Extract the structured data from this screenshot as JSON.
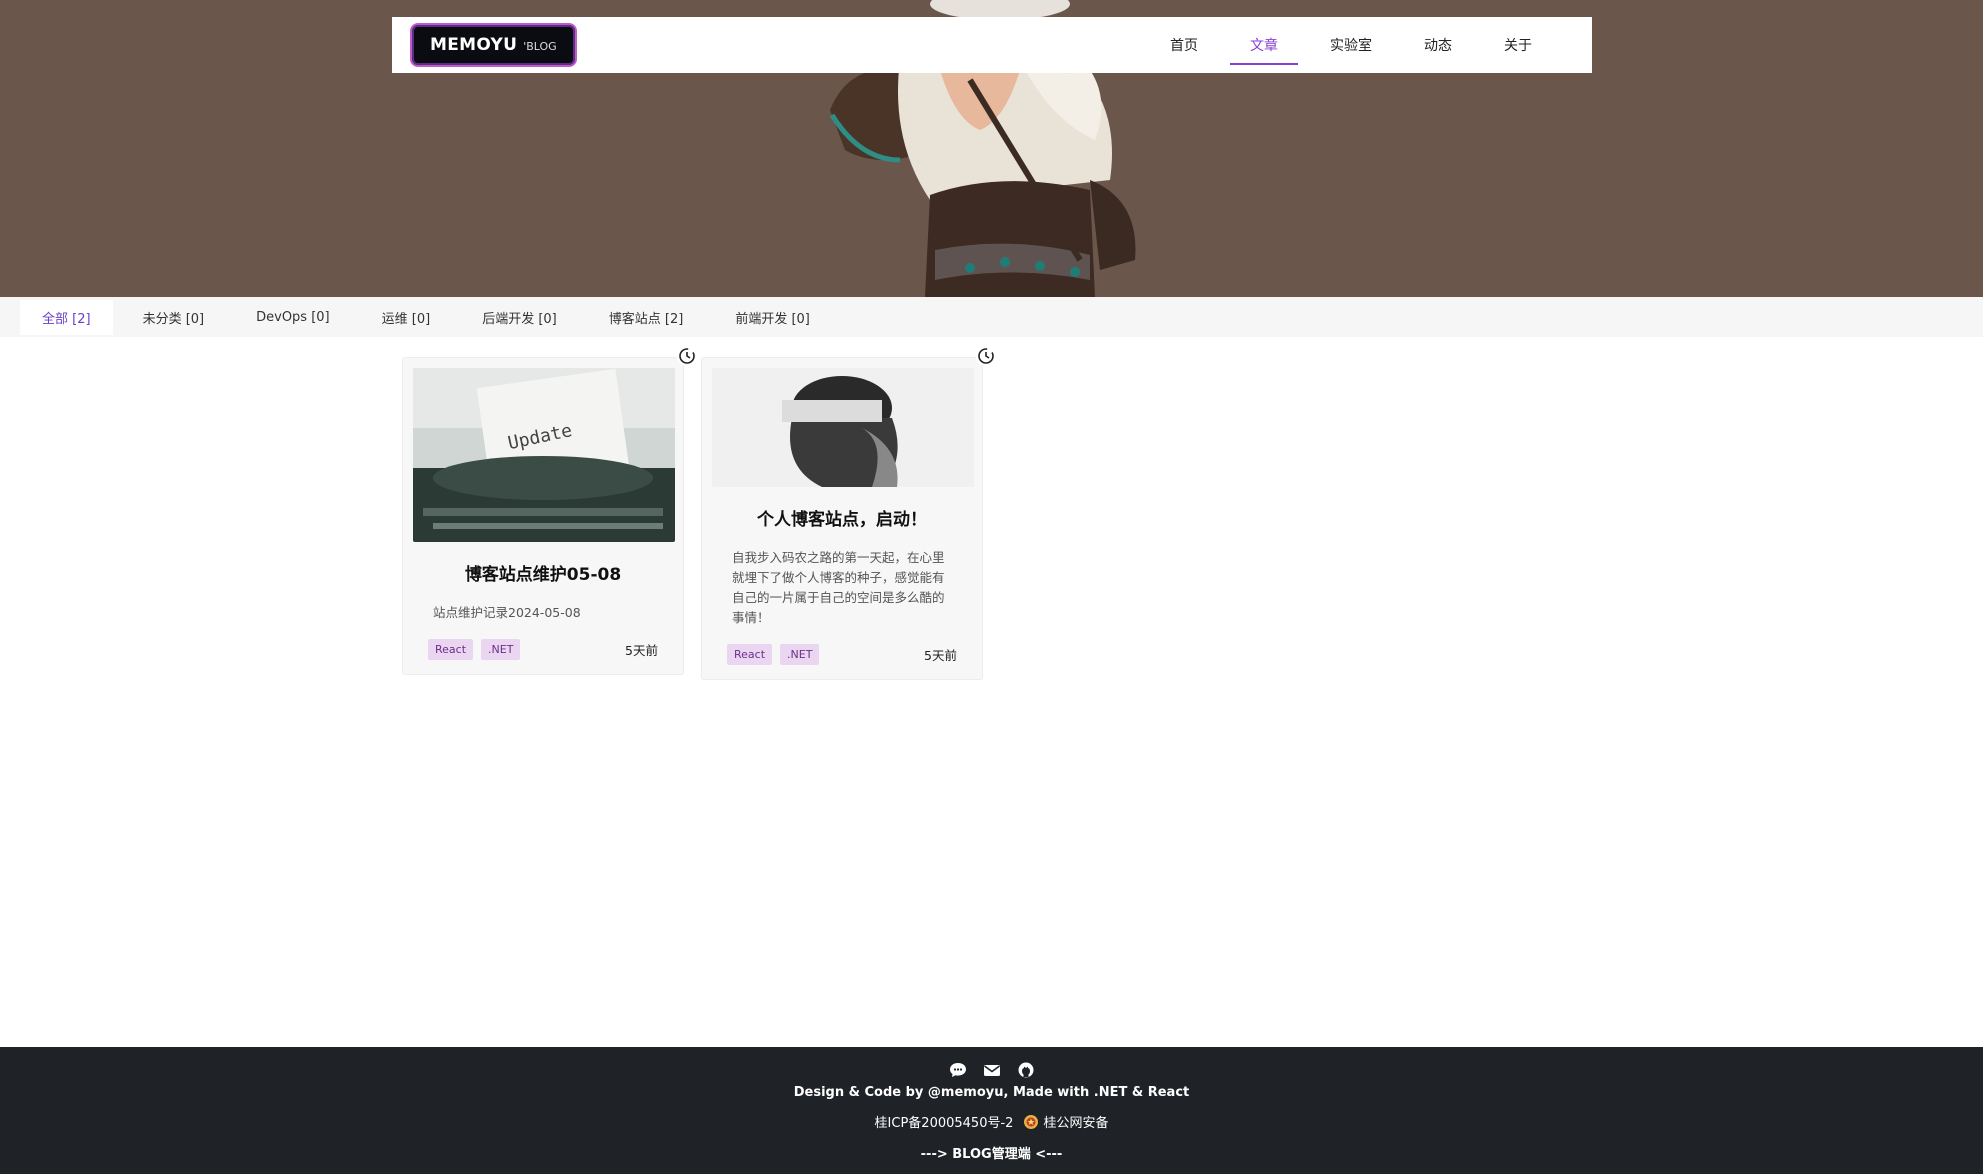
{
  "header": {
    "logo_main": "MEMOYU",
    "logo_sub": "'BLOG",
    "nav": [
      {
        "label": "首页",
        "active": false
      },
      {
        "label": "文章",
        "active": true
      },
      {
        "label": "实验室",
        "active": false
      },
      {
        "label": "动态",
        "active": false
      },
      {
        "label": "关于",
        "active": false
      }
    ]
  },
  "categories": [
    {
      "label": "全部 [2]",
      "active": true
    },
    {
      "label": "未分类 [0]"
    },
    {
      "label": "DevOps [0]"
    },
    {
      "label": "运维 [0]"
    },
    {
      "label": "后端开发 [0]"
    },
    {
      "label": "博客站点 [2]"
    },
    {
      "label": "前端开发 [0]"
    }
  ],
  "posts": [
    {
      "title": "博客站点维护05-08",
      "desc": "站点维护记录2024-05-08",
      "tags": [
        "React",
        ".NET"
      ],
      "time": "5天前",
      "thumb_text": "Update"
    },
    {
      "title": "个人博客站点，启动！",
      "desc": "自我步入码农之路的第一天起，在心里就埋下了做个人博客的种子，感觉能有自己的一片属于自己的空间是多么酷的事情！",
      "tags": [
        "React",
        ".NET"
      ],
      "time": "5天前"
    }
  ],
  "footer": {
    "icons": [
      "chat-icon",
      "mail-icon",
      "github-icon"
    ],
    "credit": "Design & Code by @memoyu, Made with .NET & React",
    "icp": "桂ICP备20005450号-2",
    "police": "桂公网安备",
    "admin": "---> BLOG管理端 <---"
  },
  "colors": {
    "hero_bg": "#6a564b",
    "accent": "#8a3fd1",
    "tag_bg": "#ebd6f1",
    "footer_bg": "#1f2227"
  }
}
